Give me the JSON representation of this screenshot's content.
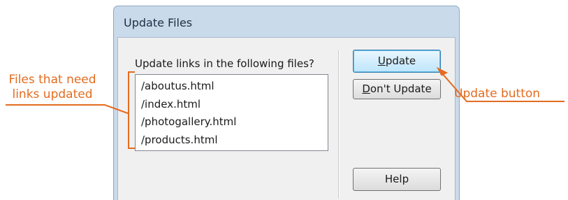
{
  "dialog": {
    "title": "Update Files",
    "prompt": "Update links in the following files?",
    "files": [
      "/aboutus.html",
      "/index.html",
      "/photogallery.html",
      "/products.html"
    ],
    "buttons": {
      "update_mnemonic": "U",
      "update_rest": "pdate",
      "dont_mnemonic": "D",
      "dont_rest": "on't Update",
      "help": "Help"
    }
  },
  "annotations": {
    "files_line1": "Files that need",
    "files_line2": "links updated",
    "update_button": "Update button",
    "color": "#e36c20"
  }
}
